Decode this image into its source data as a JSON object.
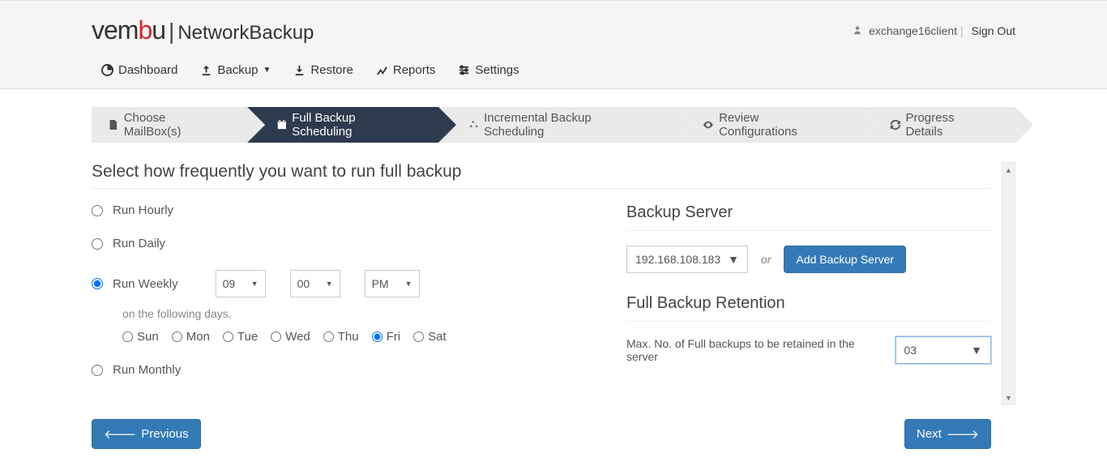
{
  "header": {
    "logo_product": "NetworkBackup",
    "username": "exchange16client",
    "signout": "Sign Out"
  },
  "nav": {
    "dashboard": "Dashboard",
    "backup": "Backup",
    "restore": "Restore",
    "reports": "Reports",
    "settings": "Settings"
  },
  "wizard": {
    "step1": "Choose MailBox(s)",
    "step2": "Full Backup Scheduling",
    "step3": "Incremental Backup Scheduling",
    "step4": "Review Configurations",
    "step5": "Progress Details"
  },
  "main": {
    "title": "Select how frequently you want to run full backup",
    "opt_hourly": "Run Hourly",
    "opt_daily": "Run Daily",
    "opt_weekly": "Run Weekly",
    "opt_monthly": "Run Monthly",
    "hour_value": "09",
    "minute_value": "00",
    "ampm_value": "PM",
    "days_label": "on the following days.",
    "days": {
      "sun": "Sun",
      "mon": "Mon",
      "tue": "Tue",
      "wed": "Wed",
      "thu": "Thu",
      "fri": "Fri",
      "sat": "Sat"
    }
  },
  "server": {
    "title": "Backup Server",
    "selected": "192.168.108.183",
    "or": "or",
    "add_btn": "Add Backup Server"
  },
  "retention": {
    "title": "Full Backup Retention",
    "label": "Max. No. of Full backups to be retained in the server",
    "value": "03"
  },
  "footer": {
    "prev": "Previous",
    "next": "Next"
  }
}
